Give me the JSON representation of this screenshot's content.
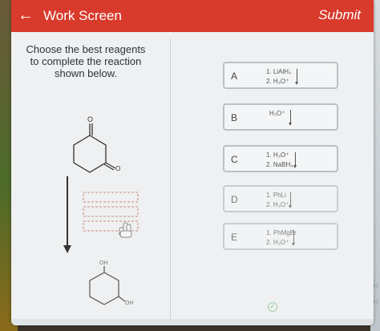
{
  "header": {
    "back_icon": "arrow-left-icon",
    "back_glyph": "←",
    "title": "Work Screen",
    "submit_label": "Submit"
  },
  "prompt": {
    "lines": [
      "Choose the best reagents",
      "to complete the reaction",
      "shown below."
    ]
  },
  "chem": {
    "start_label": "O",
    "start_ketone": "O",
    "product_oh1": "OH",
    "product_oh2": "OH"
  },
  "choices": [
    {
      "letter": "A",
      "line1": "1. LiAlH₄",
      "line2": "2. H₃O⁺"
    },
    {
      "letter": "B",
      "line1": "H₃O⁺",
      "line2": ""
    },
    {
      "letter": "C",
      "line1": "1. H₃O⁺",
      "line2": "2. NaBH₄"
    },
    {
      "letter": "D",
      "line1": "1. PhLi",
      "line2": "2. H₃O⁺"
    },
    {
      "letter": "E",
      "line1": "1. PhMgBr",
      "line2": "2. H₃O⁺"
    }
  ],
  "bg_right_glyphs": [
    "H",
    "H"
  ],
  "colors": {
    "header": "#d83a2c",
    "background": "#eef0f1",
    "drop_dash": "#d9a9a2",
    "correct": "#7bbf84"
  }
}
